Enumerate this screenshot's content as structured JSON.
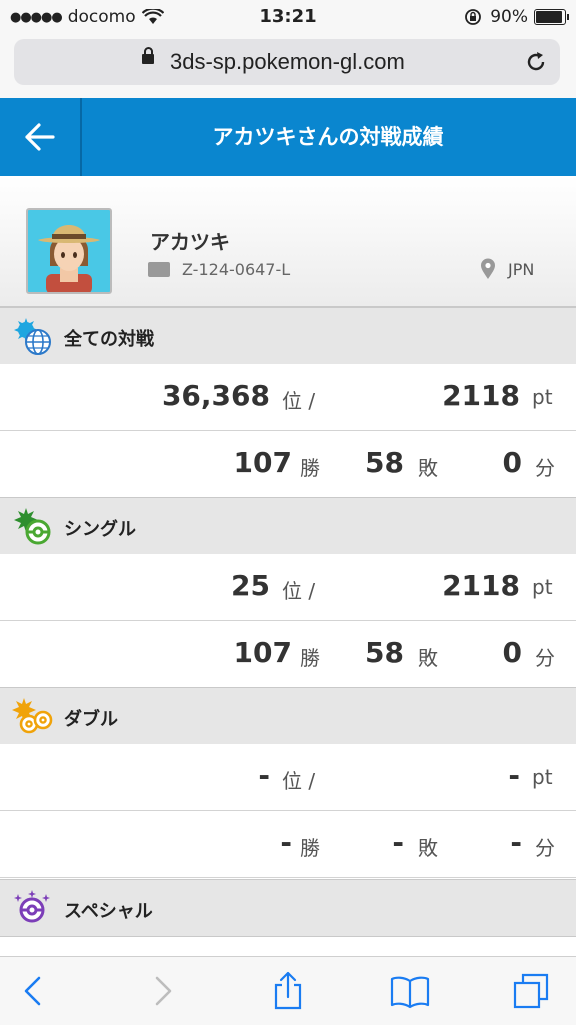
{
  "status": {
    "carrier": "docomo",
    "time": "13:21",
    "battery": "90%",
    "battery_level": 0.9
  },
  "browser": {
    "url": "3ds-sp.pokemon-gl.com"
  },
  "header": {
    "title": "アカツキさんの対戦成績"
  },
  "profile": {
    "name": "アカツキ",
    "id": "Z-124-0647-L",
    "country": "JPN"
  },
  "sections": [
    {
      "label": "全ての対戦",
      "rank": "36,368",
      "rank_unit": "位 /",
      "points": "2118",
      "points_unit": "pt",
      "wins": "107",
      "wins_unit": "勝",
      "losses": "58",
      "losses_unit": "敗",
      "draws": "0",
      "draws_unit": "分"
    },
    {
      "label": "シングル",
      "rank": "25",
      "rank_unit": "位 /",
      "points": "2118",
      "points_unit": "pt",
      "wins": "107",
      "wins_unit": "勝",
      "losses": "58",
      "losses_unit": "敗",
      "draws": "0",
      "draws_unit": "分"
    },
    {
      "label": "ダブル",
      "rank": "-",
      "rank_unit": "位 /",
      "points": "-",
      "points_unit": "pt",
      "wins": "-",
      "wins_unit": "勝",
      "losses": "-",
      "losses_unit": "敗",
      "draws": "-",
      "draws_unit": "分"
    },
    {
      "label": "スペシャル"
    }
  ],
  "colors": {
    "header": "#0a86cf",
    "section_bg": "#e6e6e6",
    "ios_blue": "#1a7cf2"
  }
}
